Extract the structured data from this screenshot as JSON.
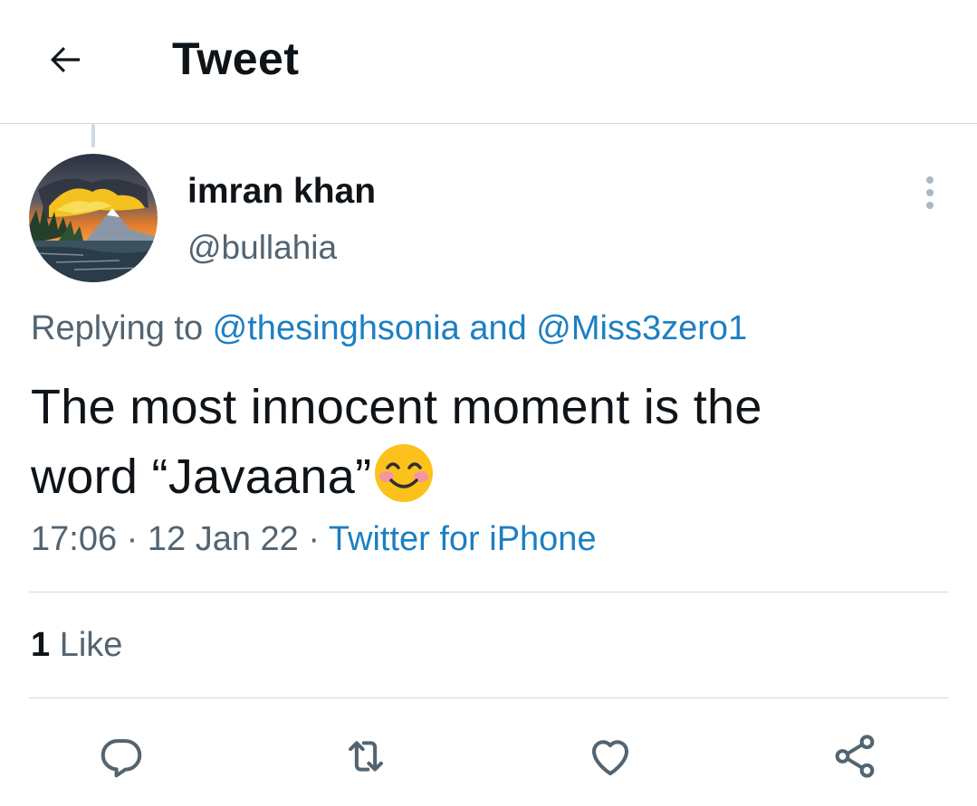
{
  "header": {
    "title": "Tweet",
    "back_icon": "arrow-left-icon"
  },
  "author": {
    "name": "imran khan",
    "handle": "@bullahia"
  },
  "reply": {
    "prefix": "Replying to ",
    "mention_1": "@thesinghsonia",
    "conjunction": " and ",
    "mention_2": "@Miss3zero1"
  },
  "tweet": {
    "line_1": "The most innocent moment is the",
    "line_2": "word “Javaana”",
    "emoji": "smiling-face-with-smiling-eyes"
  },
  "meta": {
    "time": "17:06",
    "sep_1": " · ",
    "date": "12 Jan 22",
    "sep_2": " · ",
    "source": "Twitter for iPhone"
  },
  "stats": {
    "likes_count": "1",
    "likes_label": " Like"
  },
  "actions": [
    {
      "icon": "reply-icon"
    },
    {
      "icon": "retweet-icon"
    },
    {
      "icon": "like-icon"
    },
    {
      "icon": "share-icon"
    }
  ],
  "colors": {
    "text": "#0f1419",
    "secondary": "#536471",
    "link": "#1d7fc2",
    "divider": "#d6d9db",
    "icon": "#536471"
  }
}
